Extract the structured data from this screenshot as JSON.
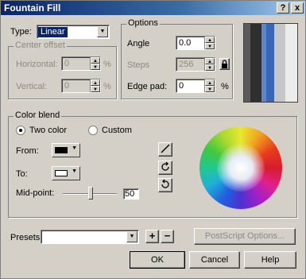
{
  "title": "Fountain Fill",
  "titlebar_buttons": {
    "help": "?",
    "close": "x"
  },
  "type": {
    "label": "Type:",
    "value": "Linear"
  },
  "center_offset": {
    "legend": "Center offset",
    "horizontal_label": "Horizontal:",
    "horizontal_value": "0",
    "horizontal_unit": "%",
    "vertical_label": "Vertical:",
    "vertical_value": "0",
    "vertical_unit": "%"
  },
  "options": {
    "legend": "Options",
    "angle_label": "Angle",
    "angle_value": "0.0",
    "steps_label": "Steps",
    "steps_value": "256",
    "edge_pad_label": "Edge pad:",
    "edge_pad_value": "0",
    "edge_pad_unit": "%"
  },
  "preview": {
    "colors": [
      "#5a5a5a",
      "#3a3a3a",
      "#4a72c0",
      "#c8c8c8",
      "#e6e6e6"
    ]
  },
  "color_blend": {
    "legend": "Color blend",
    "two_color_label": "Two color",
    "custom_label": "Custom",
    "from_label": "From:",
    "from_color": "#000000",
    "to_label": "To:",
    "to_color": "#ffffff",
    "midpoint_label": "Mid-point:",
    "midpoint_value": "50"
  },
  "presets": {
    "label": "Presets:",
    "value": "",
    "add": "+",
    "remove": "−"
  },
  "postscript_label": "PostScript Options...",
  "buttons": {
    "ok": "OK",
    "cancel": "Cancel",
    "help": "Help"
  }
}
